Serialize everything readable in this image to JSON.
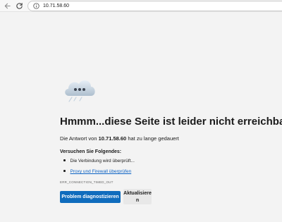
{
  "browser": {
    "url": "10.71.58.60"
  },
  "icons": {
    "back": "arrow-left-icon",
    "reload": "reload-icon",
    "site_info": "info-icon",
    "error_illustration": "cloud-error-icon"
  },
  "error": {
    "title": "Hmmm...diese Seite ist leider nicht erreichbar",
    "desc_prefix": "Die Antwort von ",
    "host": "10.71.58.60",
    "desc_suffix": " hat zu lange gedauert",
    "try_heading": "Versuchen Sie Folgendes:",
    "suggestions": [
      "Die Verbindung wird überprüft...",
      "Proxy und Firewall überprüfen"
    ],
    "code": "ERR_CONNECTION_TIMED_OUT"
  },
  "buttons": {
    "diagnose": "Problem diagnostizieren",
    "reload": "Aktualisieren"
  },
  "colors": {
    "primary_button": "#0f6cbd",
    "link": "#0b62c4",
    "page_background": "#f3f3f3"
  }
}
